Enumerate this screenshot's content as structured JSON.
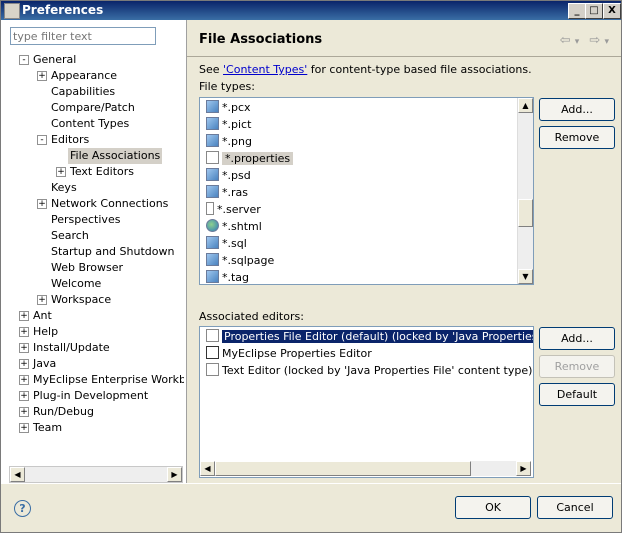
{
  "window": {
    "title": "Preferences",
    "minimize": "_",
    "maximize": "□",
    "close": "X"
  },
  "filter": {
    "placeholder": "type filter text"
  },
  "tree": [
    {
      "label": "General",
      "level": 0,
      "exp": "-",
      "sel": false
    },
    {
      "label": "Appearance",
      "level": 1,
      "exp": "+",
      "sel": false
    },
    {
      "label": "Capabilities",
      "level": 1,
      "exp": "",
      "sel": false
    },
    {
      "label": "Compare/Patch",
      "level": 1,
      "exp": "",
      "sel": false
    },
    {
      "label": "Content Types",
      "level": 1,
      "exp": "",
      "sel": false
    },
    {
      "label": "Editors",
      "level": 1,
      "exp": "-",
      "sel": false
    },
    {
      "label": "File Associations",
      "level": 2,
      "exp": "",
      "sel": true
    },
    {
      "label": "Text Editors",
      "level": 2,
      "exp": "+",
      "sel": false
    },
    {
      "label": "Keys",
      "level": 1,
      "exp": "",
      "sel": false
    },
    {
      "label": "Network Connections",
      "level": 1,
      "exp": "+",
      "sel": false
    },
    {
      "label": "Perspectives",
      "level": 1,
      "exp": "",
      "sel": false
    },
    {
      "label": "Search",
      "level": 1,
      "exp": "",
      "sel": false
    },
    {
      "label": "Startup and Shutdown",
      "level": 1,
      "exp": "",
      "sel": false
    },
    {
      "label": "Web Browser",
      "level": 1,
      "exp": "",
      "sel": false
    },
    {
      "label": "Welcome",
      "level": 1,
      "exp": "",
      "sel": false
    },
    {
      "label": "Workspace",
      "level": 1,
      "exp": "+",
      "sel": false
    },
    {
      "label": "Ant",
      "level": 0,
      "exp": "+",
      "sel": false
    },
    {
      "label": "Help",
      "level": 0,
      "exp": "+",
      "sel": false
    },
    {
      "label": "Install/Update",
      "level": 0,
      "exp": "+",
      "sel": false
    },
    {
      "label": "Java",
      "level": 0,
      "exp": "+",
      "sel": false
    },
    {
      "label": "MyEclipse Enterprise Workbenc",
      "level": 0,
      "exp": "+",
      "sel": false
    },
    {
      "label": "Plug-in Development",
      "level": 0,
      "exp": "+",
      "sel": false
    },
    {
      "label": "Run/Debug",
      "level": 0,
      "exp": "+",
      "sel": false
    },
    {
      "label": "Team",
      "level": 0,
      "exp": "+",
      "sel": false
    }
  ],
  "page": {
    "title": "File Associations",
    "back_icon": "⇦",
    "forward_icon": "⇨",
    "menu_icon": "▾",
    "see_prefix": "See ",
    "see_link": "'Content Types'",
    "see_suffix": " for content-type based file associations.",
    "file_types_label": "File types:",
    "associated_label": "Associated editors:"
  },
  "file_types": [
    {
      "label": "*.pcx",
      "icon": "image-icon",
      "sel": false
    },
    {
      "label": "*.pict",
      "icon": "image-icon",
      "sel": false
    },
    {
      "label": "*.png",
      "icon": "image-icon",
      "sel": false
    },
    {
      "label": "*.properties",
      "icon": "document-icon",
      "sel": true
    },
    {
      "label": "*.psd",
      "icon": "image-icon",
      "sel": false
    },
    {
      "label": "*.ras",
      "icon": "image-icon",
      "sel": false
    },
    {
      "label": "*.server",
      "icon": "server-icon",
      "sel": false
    },
    {
      "label": "*.shtml",
      "icon": "globe-icon",
      "sel": false
    },
    {
      "label": "*.sql",
      "icon": "sql-icon",
      "sel": false
    },
    {
      "label": "*.sqlpage",
      "icon": "sql-icon",
      "sel": false
    },
    {
      "label": "*.tag",
      "icon": "tag-icon",
      "sel": false
    }
  ],
  "file_buttons": {
    "add": "Add...",
    "remove": "Remove"
  },
  "editors": [
    {
      "label": "Properties File Editor (default) (locked by 'Java Properties File' co",
      "icon": "document-icon",
      "sel": true
    },
    {
      "label": "MyEclipse Properties Editor",
      "icon": "table-icon",
      "sel": false
    },
    {
      "label": "Text Editor (locked by 'Java Properties File' content type)",
      "icon": "document-icon",
      "sel": false
    }
  ],
  "editor_buttons": {
    "add": "Add...",
    "remove": "Remove",
    "default": "Default"
  },
  "footer": {
    "help_icon": "?",
    "ok": "OK",
    "cancel": "Cancel"
  },
  "colors": {
    "selection": "#0a246a",
    "titlebar": "#0a246a",
    "link": "#0000cc"
  }
}
